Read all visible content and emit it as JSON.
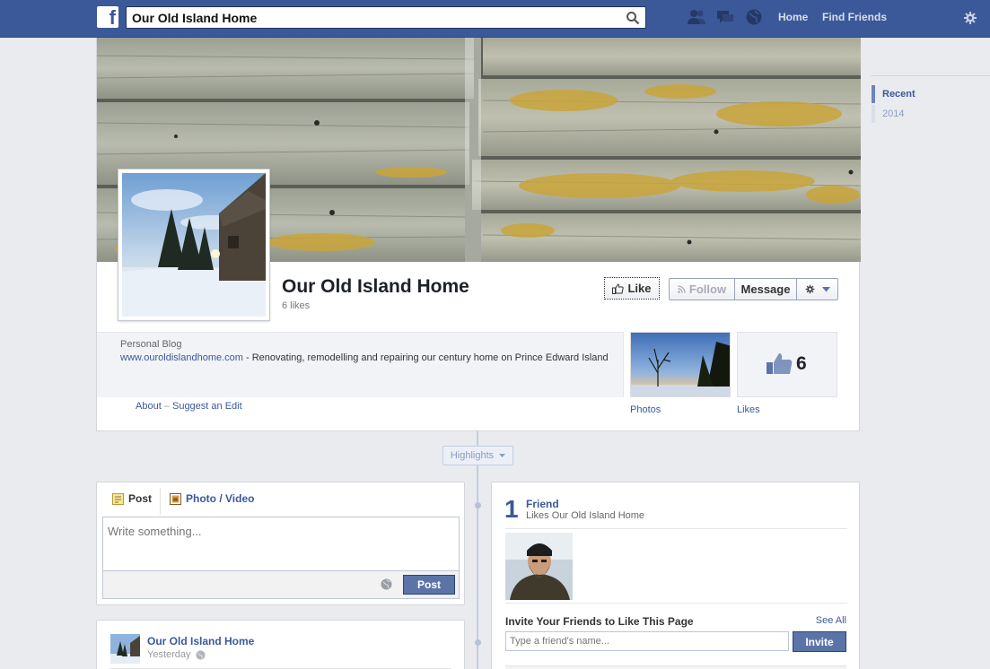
{
  "topbar": {
    "logo_letter": "f",
    "search_value": "Our Old Island Home",
    "nav": [
      "Home",
      "Find Friends"
    ],
    "accent": "#3b5998"
  },
  "timeline_years": [
    {
      "label": "Recent",
      "active": true
    },
    {
      "label": "2014",
      "active": false
    }
  ],
  "page": {
    "title": "Our Old Island Home",
    "likes": "6 likes",
    "category": "Personal Blog",
    "website": "www.ouroldislandhome.com",
    "description": " - Renovating, remodelling and repairing our century home on Prince Edward Island",
    "about_link": "About",
    "separator": " – ",
    "suggest_link": "Suggest an Edit"
  },
  "actions": {
    "like": "Like",
    "follow": "Follow",
    "message": "Message"
  },
  "tiles": {
    "photos_label": "Photos",
    "likes_label": "Likes",
    "likes_number": "6"
  },
  "highlights": "Highlights",
  "composer": {
    "tab_post": "Post",
    "tab_photo": "Photo / Video",
    "placeholder": "Write something...",
    "post_button": "Post"
  },
  "story": {
    "author": "Our Old Island Home",
    "time": "Yesterday"
  },
  "friends": {
    "count": "1",
    "title": "Friend",
    "subtitle": "Likes Our Old Island Home",
    "invite_title": "Invite Your Friends to Like This Page",
    "see_all": "See All",
    "invite_placeholder": "Type a friend's name...",
    "invite_button": "Invite"
  }
}
